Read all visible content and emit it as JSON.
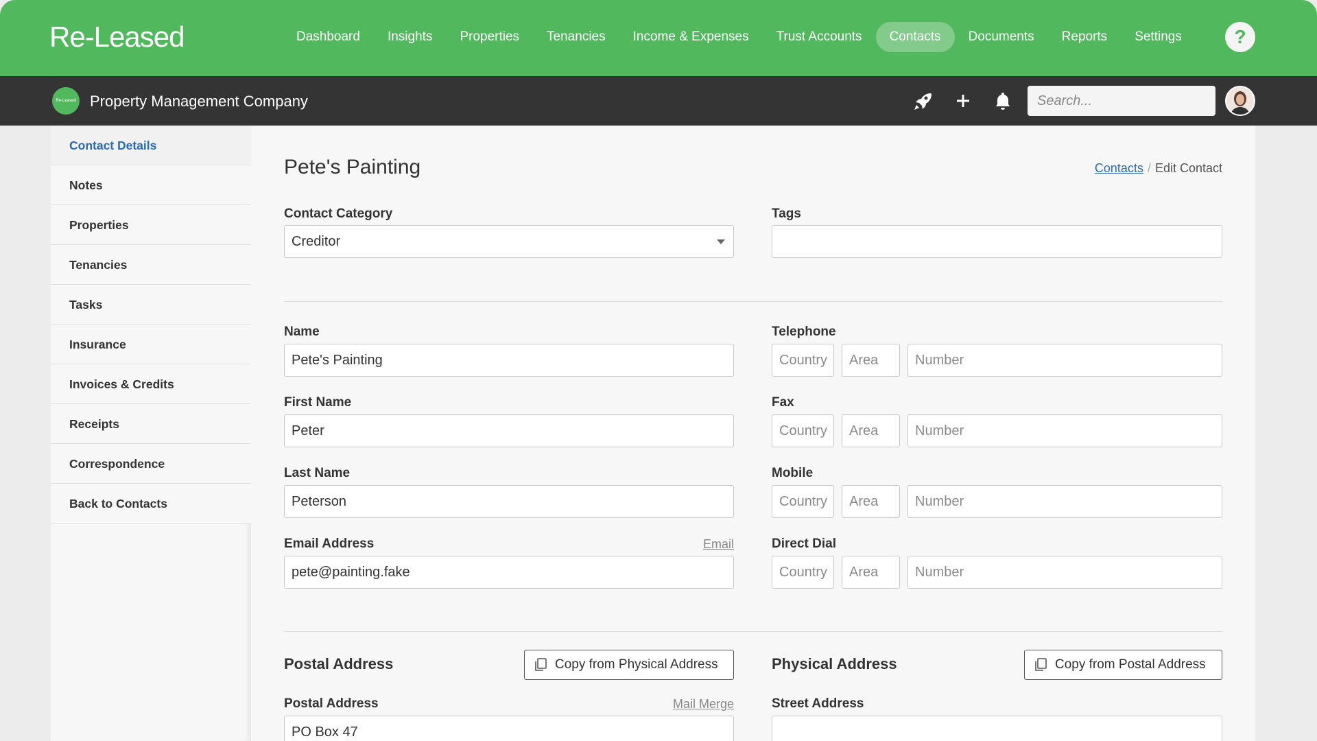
{
  "app": {
    "logo": "Re-Leased"
  },
  "nav": {
    "items": [
      "Dashboard",
      "Insights",
      "Properties",
      "Tenancies",
      "Income & Expenses",
      "Trust Accounts",
      "Contacts",
      "Documents",
      "Reports",
      "Settings"
    ],
    "active": "Contacts",
    "help": "?"
  },
  "subbar": {
    "logo_text": "Re-Leased",
    "company": "Property Management Company",
    "search_placeholder": "Search..."
  },
  "sidebar": {
    "items": [
      "Contact Details",
      "Notes",
      "Properties",
      "Tenancies",
      "Tasks",
      "Insurance",
      "Invoices & Credits",
      "Receipts",
      "Correspondence",
      "Back to Contacts"
    ],
    "active": "Contact Details"
  },
  "page": {
    "title": "Pete's Painting",
    "breadcrumb": {
      "link": "Contacts",
      "sep": "/",
      "current": "Edit Contact"
    }
  },
  "form": {
    "contact_category": {
      "label": "Contact Category",
      "value": "Creditor"
    },
    "tags": {
      "label": "Tags",
      "value": ""
    },
    "name": {
      "label": "Name",
      "value": "Pete's Painting"
    },
    "first_name": {
      "label": "First Name",
      "value": "Peter"
    },
    "last_name": {
      "label": "Last Name",
      "value": "Peterson"
    },
    "email": {
      "label": "Email Address",
      "value": "pete@painting.fake",
      "link": "Email"
    },
    "phone_placeholders": {
      "country": "Country",
      "area": "Area",
      "number": "Number"
    },
    "telephone": {
      "label": "Telephone"
    },
    "fax": {
      "label": "Fax"
    },
    "mobile": {
      "label": "Mobile"
    },
    "direct_dial": {
      "label": "Direct Dial"
    },
    "postal_section": {
      "title": "Postal Address",
      "button": "Copy from Physical Address"
    },
    "physical_section": {
      "title": "Physical Address",
      "button": "Copy from Postal Address"
    },
    "postal_address": {
      "label": "Postal Address",
      "value": "PO Box 47",
      "link": "Mail Merge"
    },
    "street_address": {
      "label": "Street Address",
      "value": ""
    }
  },
  "colors": {
    "brand_green": "#52b85e",
    "dark_bar": "#343434",
    "link_blue": "#2c6bb0"
  }
}
